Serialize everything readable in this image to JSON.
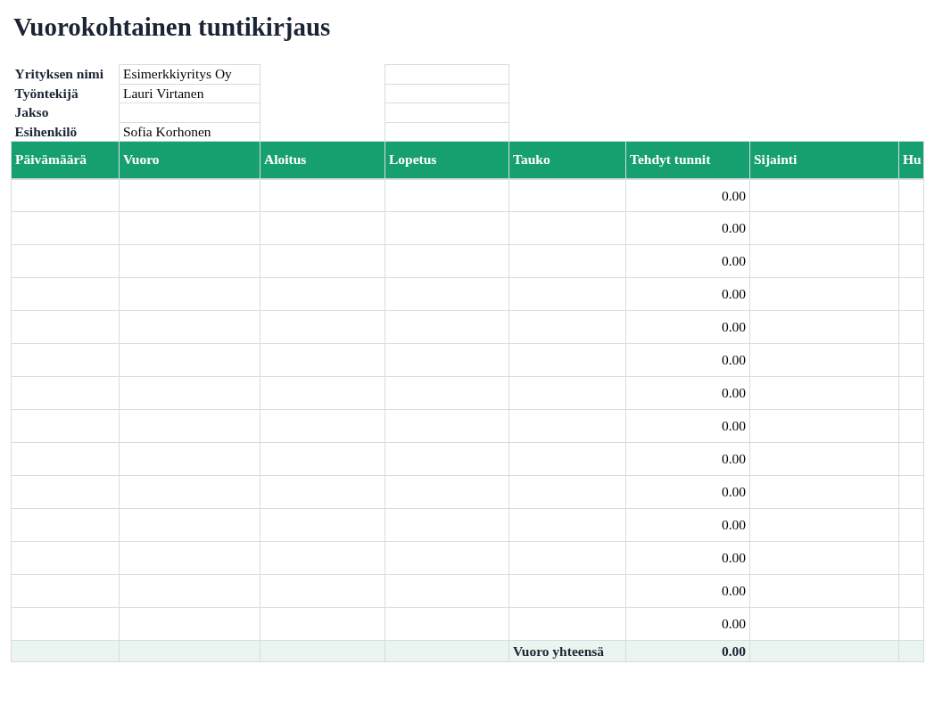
{
  "title": "Vuorokohtainen tuntikirjaus",
  "info": [
    {
      "label": "Yrityksen nimi",
      "value": "Esimerkkiyritys Oy"
    },
    {
      "label": "Työntekijä",
      "value": "Lauri Virtanen"
    },
    {
      "label": "Jakso"
    },
    {
      "label": "Esihenkilö",
      "value": "Sofia Korhonen"
    }
  ],
  "table": {
    "columns": [
      "Päivämäärä",
      "Vuoro",
      "Aloitus",
      "Lopetus",
      "Tauko",
      "Tehdyt tunnit",
      "Sijainti",
      "Hu"
    ],
    "rows": [
      {
        "hours": "0.00"
      },
      {
        "hours": "0.00"
      },
      {
        "hours": "0.00"
      },
      {
        "hours": "0.00"
      },
      {
        "hours": "0.00"
      },
      {
        "hours": "0.00"
      },
      {
        "hours": "0.00"
      },
      {
        "hours": "0.00"
      },
      {
        "hours": "0.00"
      },
      {
        "hours": "0.00"
      },
      {
        "hours": "0.00"
      },
      {
        "hours": "0.00"
      },
      {
        "hours": "0.00"
      },
      {
        "hours": "0.00"
      }
    ],
    "footer": {
      "label": "Vuoro yhteensä",
      "total": "0.00"
    }
  }
}
